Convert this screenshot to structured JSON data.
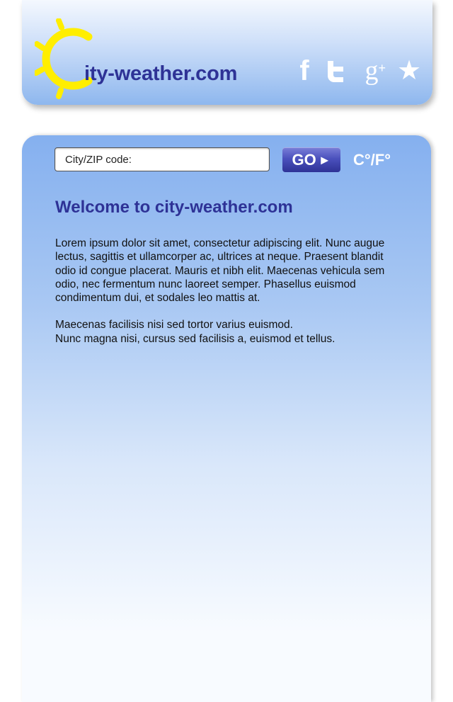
{
  "header": {
    "logo_text": "ity-weather.com",
    "logo_colors": {
      "sun": "#ffee00",
      "text": "#2e3296"
    },
    "social_icons": [
      "facebook-icon",
      "twitter-icon",
      "google-plus-icon",
      "star-icon"
    ],
    "google_plus_glyph": "g",
    "google_plus_sup": "+"
  },
  "search": {
    "placeholder": "City/ZIP code:",
    "go_label": "GO",
    "go_arrow": "►",
    "unit_toggle": "C°/F°"
  },
  "main": {
    "title": "Welcome to city-weather.com",
    "paragraphs": [
      "Lorem ipsum dolor sit amet, consectetur adipiscing elit. Nunc augue lectus, sagittis et ullamcorper ac, ultrices at neque. Praesent blandit odio id congue placerat. Mauris et nibh elit. Maecenas vehicula sem odio, nec fermentum nunc laoreet semper. Phasellus euismod condimentum dui, et sodales leo mattis at.",
      "Maecenas facilisis nisi sed tortor varius euismod.\nNunc magna nisi, cursus sed facilisis a, euismod et tellus."
    ]
  },
  "colors": {
    "accent": "#2e3296",
    "panel_top": "#85b0ef",
    "panel_bottom": "#f8fbff",
    "button": "#4b51bd"
  }
}
